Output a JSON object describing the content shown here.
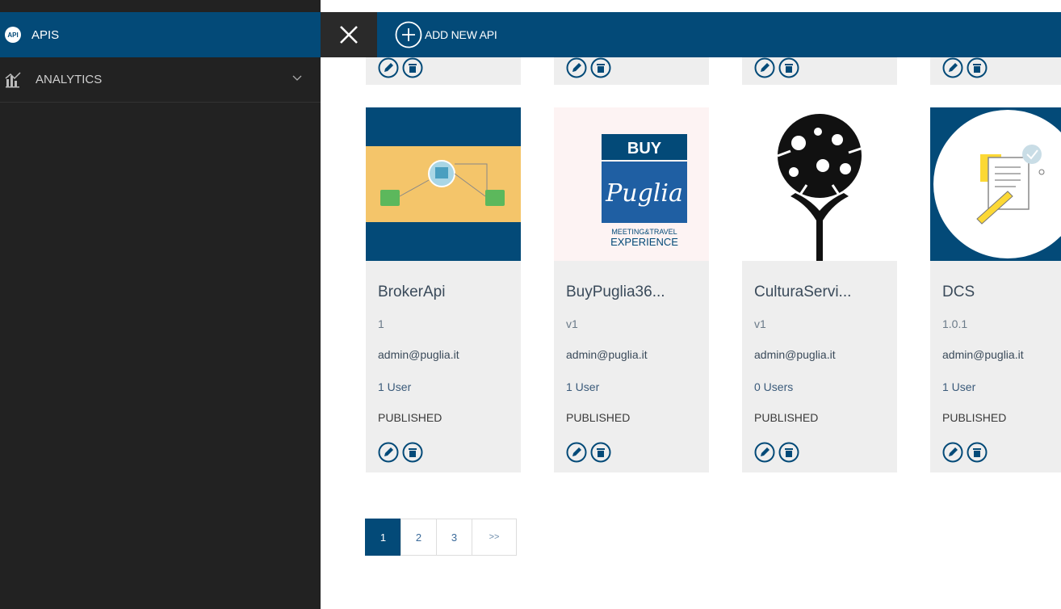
{
  "sidebar": {
    "apis_label": "APIS",
    "apis_icon": "api-gear-icon",
    "analytics_label": "ANALYTICS",
    "analytics_icon": "analytics-chart-icon"
  },
  "topbar": {
    "add_label": "ADD NEW API"
  },
  "cards": [
    {
      "title": "BrokerApi",
      "version": "1",
      "owner": "admin@puglia.it",
      "users": "1 User",
      "status": "PUBLISHED",
      "thumbnail": "broker-diagram-thumbnail"
    },
    {
      "title": "BuyPuglia36...",
      "version": "v1",
      "owner": "admin@puglia.it",
      "users": "1 User",
      "status": "PUBLISHED",
      "thumbnail": "buy-puglia-logo"
    },
    {
      "title": "CulturaServi...",
      "version": "v1",
      "owner": "admin@puglia.it",
      "users": "0 Users",
      "status": "PUBLISHED",
      "thumbnail": "culture-tree-illustration"
    },
    {
      "title": "DCS",
      "version": "1.0.1",
      "owner": "admin@puglia.it",
      "users": "1 User",
      "status": "PUBLISHED",
      "thumbnail": "document-pencil-illustration"
    }
  ],
  "logo": {
    "buy": "BUY",
    "script": "Puglia",
    "tag1": "MEETING&TRAVEL",
    "tag2": "EXPERIENCE"
  },
  "pagination": {
    "pages": [
      "1",
      "2",
      "3"
    ],
    "next": ">>",
    "current": "1"
  },
  "colors": {
    "primary": "#034a78",
    "sidebar": "#222222",
    "card": "#eeeeee"
  }
}
